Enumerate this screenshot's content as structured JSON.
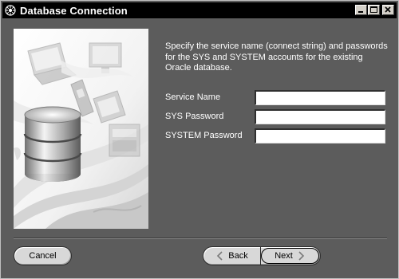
{
  "window": {
    "title": "Database Connection",
    "controls": [
      "minimize",
      "maximize",
      "close"
    ]
  },
  "illustration": {
    "description_icon": "database-cylinder-with-devices"
  },
  "intro": {
    "text": "Specify the service name (connect string) and passwords for the SYS and SYSTEM accounts for the existing Oracle database."
  },
  "form": {
    "fields": [
      {
        "label": "Service Name",
        "value": ""
      },
      {
        "label": "SYS Password",
        "value": ""
      },
      {
        "label": "SYSTEM Password",
        "value": ""
      }
    ]
  },
  "buttons": {
    "cancel": "Cancel",
    "back": "Back",
    "next": "Next"
  },
  "colors": {
    "background": "#5c5c5c",
    "titlebar": "#000000",
    "button_face": "#d8d8d8"
  }
}
